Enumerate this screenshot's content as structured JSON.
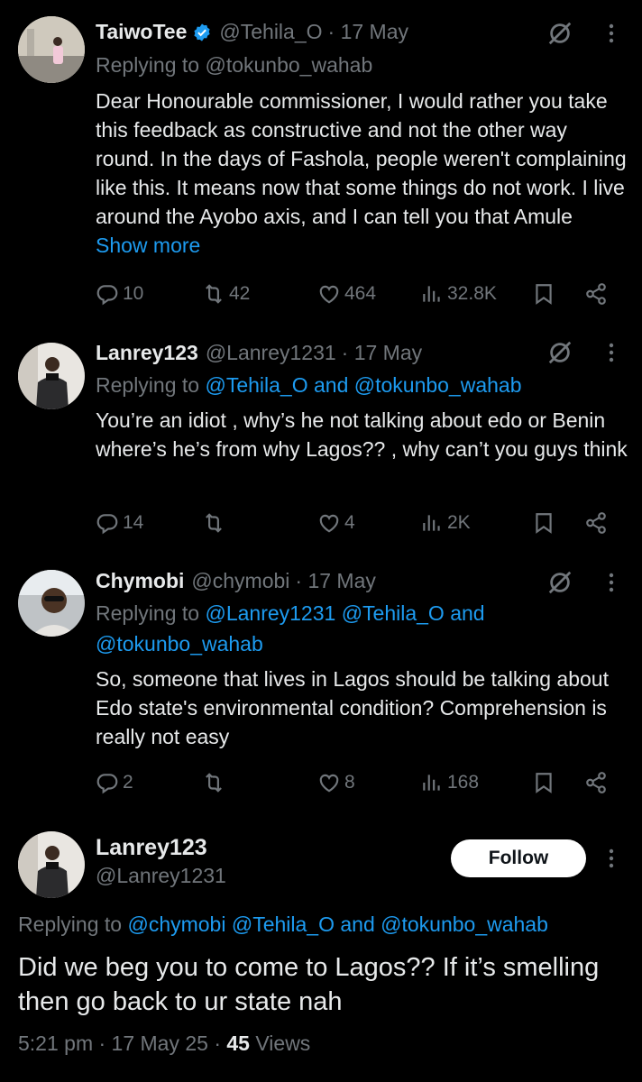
{
  "tweets": [
    {
      "name": "TaiwoTee",
      "handle": "@Tehila_O",
      "date": "· 17 May",
      "replying_prefix": "Replying to",
      "replying_to": "@tokunbo_wahab",
      "text": "Dear Honourable commissioner, I would rather you take this feedback as constructive and not the other way round. In the days of Fashola, people weren't complaining like this. It means now that some things do not work. I live around the Ayobo axis, and I can tell you that Amule",
      "show_more": "Show more",
      "replies": "10",
      "reposts": "42",
      "likes": "464",
      "views": "32.8K"
    },
    {
      "name": "Lanrey123",
      "handle": "@Lanrey1231",
      "date": "· 17 May",
      "replying_prefix": "Replying to",
      "replying_to": "@Tehila_O and @tokunbo_wahab",
      "text": "You’re an idiot , why’s he not talking about edo or Benin where’s he’s from why Lagos?? , why can’t you guys think",
      "replies": "14",
      "reposts": "",
      "likes": "4",
      "views": "2K"
    },
    {
      "name": "Chymobi",
      "handle": "@chymobi",
      "date": "· 17 May",
      "replying_prefix": "Replying to",
      "replying_to_line1": "@Lanrey1231 @Tehila_O and",
      "replying_to_line2": "@tokunbo_wahab",
      "text": "So, someone that lives in Lagos should be talking about Edo state's environmental condition? Comprehension is really not easy",
      "replies": "2",
      "reposts": "",
      "likes": "8",
      "views": "168"
    }
  ],
  "focused": {
    "name": "Lanrey123",
    "handle": "@Lanrey1231",
    "follow_label": "Follow",
    "replying_prefix": "Replying to",
    "replying_to": "@chymobi @Tehila_O and @tokunbo_wahab",
    "text": "Did we beg you to come to Lagos?? If it’s smelling then go back to ur state nah",
    "time": "5:21 pm · 17 May 25 · ",
    "views_count": "45",
    "views_label": " Views"
  },
  "colors": {
    "background": "#000000",
    "text": "#e7e9ea",
    "muted": "#71767b",
    "link": "#1d9bf0",
    "verified": "#1d9bf0"
  },
  "icons": [
    "reply-icon",
    "repost-icon",
    "like-icon",
    "views-icon",
    "bookmark-icon",
    "share-icon",
    "grok-icon",
    "more-icon",
    "verified-badge-icon"
  ]
}
